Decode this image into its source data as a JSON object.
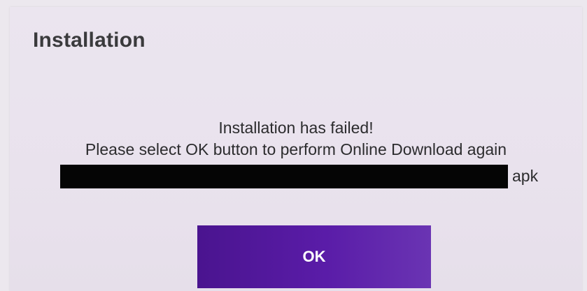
{
  "dialog": {
    "title": "Installation",
    "message_lines": [
      "Installation has failed!",
      "Please select OK button to perform Online Download again"
    ],
    "file_suffix": "apk"
  },
  "buttons": {
    "ok_label": "OK"
  },
  "colors": {
    "dialog_background": "#ebe5ef",
    "button_background": "#5a1ca8",
    "button_text": "#ffffff",
    "redaction": "#050505"
  }
}
